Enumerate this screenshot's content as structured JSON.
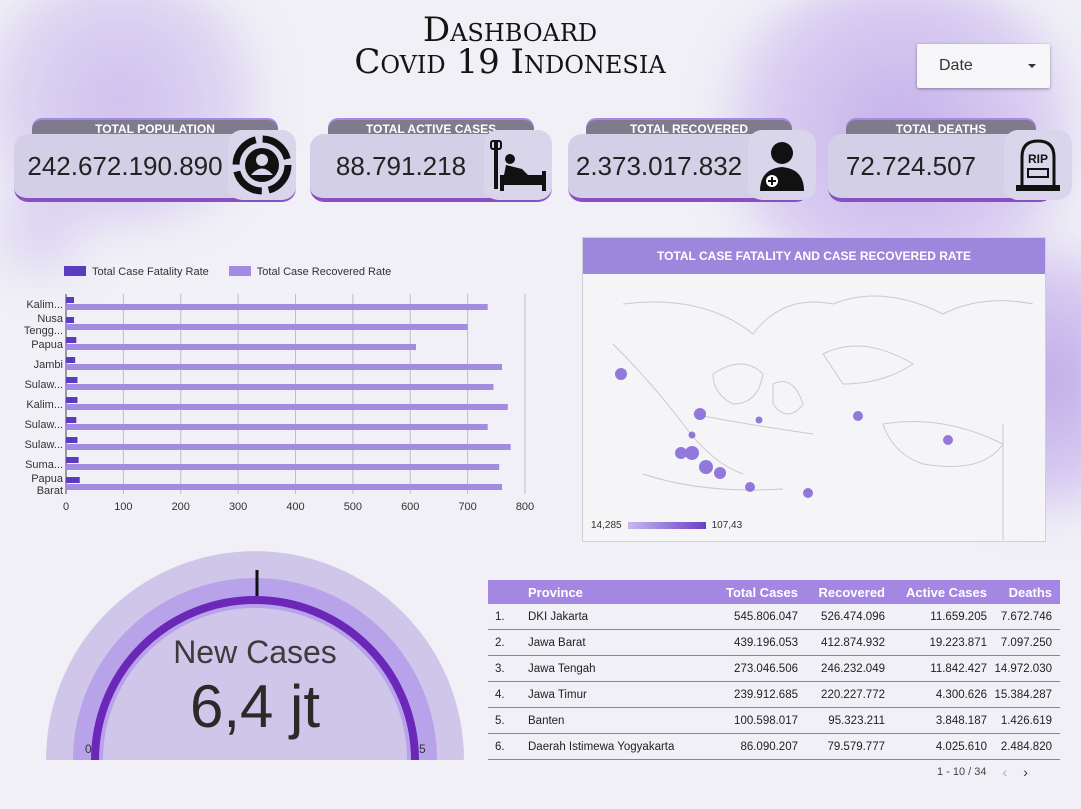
{
  "title": {
    "line1": "Dashboard",
    "line2": "Covid 19 Indonesia"
  },
  "date_filter": {
    "label": "Date"
  },
  "kpis": [
    {
      "label": "TOTAL POPULATION",
      "value": "242.672.190.890",
      "icon": "population-icon"
    },
    {
      "label": "TOTAL ACTIVE CASES",
      "value": "88.791.218",
      "icon": "hospital-bed-icon"
    },
    {
      "label": "TOTAL RECOVERED",
      "value": "2.373.017.832",
      "icon": "doctor-icon"
    },
    {
      "label": "TOTAL DEATHS",
      "value": "72.724.507",
      "icon": "tombstone-icon"
    }
  ],
  "tombstone_text": "RIP",
  "colors": {
    "accent": "#6a3fc7",
    "bar_fatality": "#5b3bbf",
    "bar_recovered": "#a28be0",
    "table_header": "#a486e3"
  },
  "chart_data": {
    "type": "bar",
    "orientation": "horizontal",
    "categories": [
      "Kalim...",
      "Nusa Tengg...",
      "Papua",
      "Jambi",
      "Sulaw...",
      "Kalim...",
      "Sulaw...",
      "Sulaw...",
      "Suma...",
      "Papua Barat"
    ],
    "category_rows": [
      [
        "Kalim..."
      ],
      [
        "Nusa",
        "Tengg..."
      ],
      [
        "Papua"
      ],
      [
        "Jambi"
      ],
      [
        "Sulaw..."
      ],
      [
        "Kalim..."
      ],
      [
        "Sulaw..."
      ],
      [
        "Sulaw..."
      ],
      [
        "Suma..."
      ],
      [
        "Papua",
        "Barat"
      ]
    ],
    "series": [
      {
        "name": "Total Case Fatality Rate",
        "values": [
          14,
          14,
          18,
          16,
          20,
          20,
          18,
          20,
          22,
          24
        ]
      },
      {
        "name": "Total Case Recovered Rate",
        "values": [
          735,
          700,
          610,
          760,
          745,
          770,
          735,
          775,
          755,
          760
        ]
      }
    ],
    "xlim": [
      0,
      800
    ],
    "xticks": [
      0,
      100,
      200,
      300,
      400,
      500,
      600,
      700,
      800
    ],
    "grid": true,
    "legend": "top-left"
  },
  "map": {
    "title": "TOTAL CASE FATALITY AND CASE RECOVERED RATE",
    "scale_min": "14,285",
    "scale_max": "107,43"
  },
  "gauge": {
    "label": "New Cases",
    "value": "6,4 jt",
    "min": "0",
    "max": "5",
    "fill_fraction": 1.0
  },
  "table": {
    "headers": [
      "Province",
      "Total Cases",
      "Recovered",
      "Active Cases",
      "Deaths"
    ],
    "rows": [
      [
        "1.",
        "DKI Jakarta",
        "545.806.047",
        "526.474.096",
        "11.659.205",
        "7.672.746"
      ],
      [
        "2.",
        "Jawa Barat",
        "439.196.053",
        "412.874.932",
        "19.223.871",
        "7.097.250"
      ],
      [
        "3.",
        "Jawa Tengah",
        "273.046.506",
        "246.232.049",
        "11.842.427",
        "14.972.030"
      ],
      [
        "4.",
        "Jawa Timur",
        "239.912.685",
        "220.227.772",
        "4.300.626",
        "15.384.287"
      ],
      [
        "5.",
        "Banten",
        "100.598.017",
        "95.323.211",
        "3.848.187",
        "1.426.619"
      ],
      [
        "6.",
        "Daerah Istimewa Yogyakarta",
        "86.090.207",
        "79.579.777",
        "4.025.610",
        "2.484.820"
      ]
    ],
    "pagination": "1 - 10 / 34"
  }
}
